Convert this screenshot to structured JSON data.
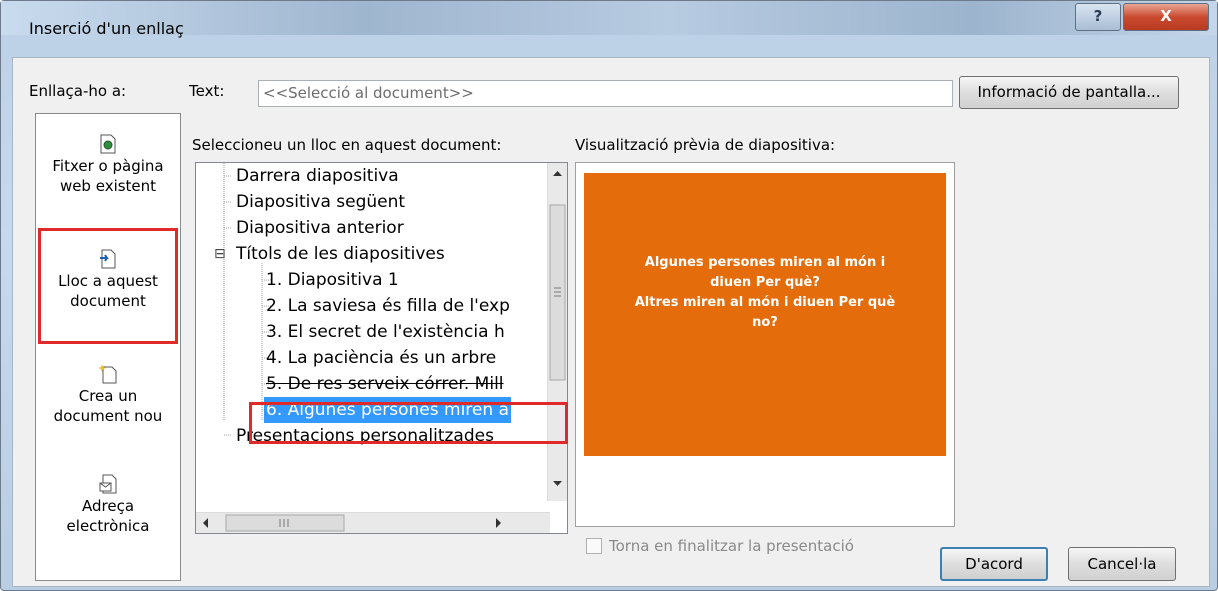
{
  "dialog": {
    "title": "Inserció d'un enllaç",
    "help_glyph": "?",
    "close_glyph": "X"
  },
  "link_to": {
    "label": "Enllaça-ho a:",
    "items": [
      {
        "line1": "Fitxer o pàgina",
        "line2": "web existent",
        "icon": "file-web-icon"
      },
      {
        "line1": "Lloc a aquest",
        "line2": "document",
        "icon": "place-in-document-icon"
      },
      {
        "line1": "Crea un",
        "line2": "document nou",
        "icon": "new-document-icon"
      },
      {
        "line1": "Adreça",
        "line2": "electrònica",
        "icon": "email-address-icon"
      }
    ]
  },
  "text_field": {
    "label": "Text:",
    "value": "<<Selecció al document>>"
  },
  "screentip_button": "Informació de pantalla...",
  "place_list": {
    "label": "Seleccioneu un lloc en aquest document:",
    "items": [
      "Darrera diapositiva",
      "Diapositiva següent",
      "Diapositiva anterior",
      "Títols de les diapositives",
      "1. Diapositiva 1",
      "2. La saviesa és filla  de l'exp",
      "3. El secret de l'existència h",
      "4. La paciència  és un arbre",
      "5. De res serveix córrer. Mill",
      "6. Algunes persones miren a",
      "Presentacions personalitzades"
    ],
    "selected_index": 9,
    "expander_glyph": "⊟"
  },
  "preview": {
    "label": "Visualització prèvia de diapositiva:",
    "slide_lines": [
      "Algunes persones miren al món i",
      "diuen Per què?",
      "Altres miren al món i diuen Per què",
      "no?"
    ],
    "slide_color": "#e46c0a"
  },
  "return_checkbox": {
    "label": "Torna en finalitzar la presentació",
    "checked": false
  },
  "ok_button": "D'acord",
  "cancel_button": "Cancel·la",
  "colors": {
    "highlight": "#e02a2a",
    "selection": "#3399ff"
  }
}
